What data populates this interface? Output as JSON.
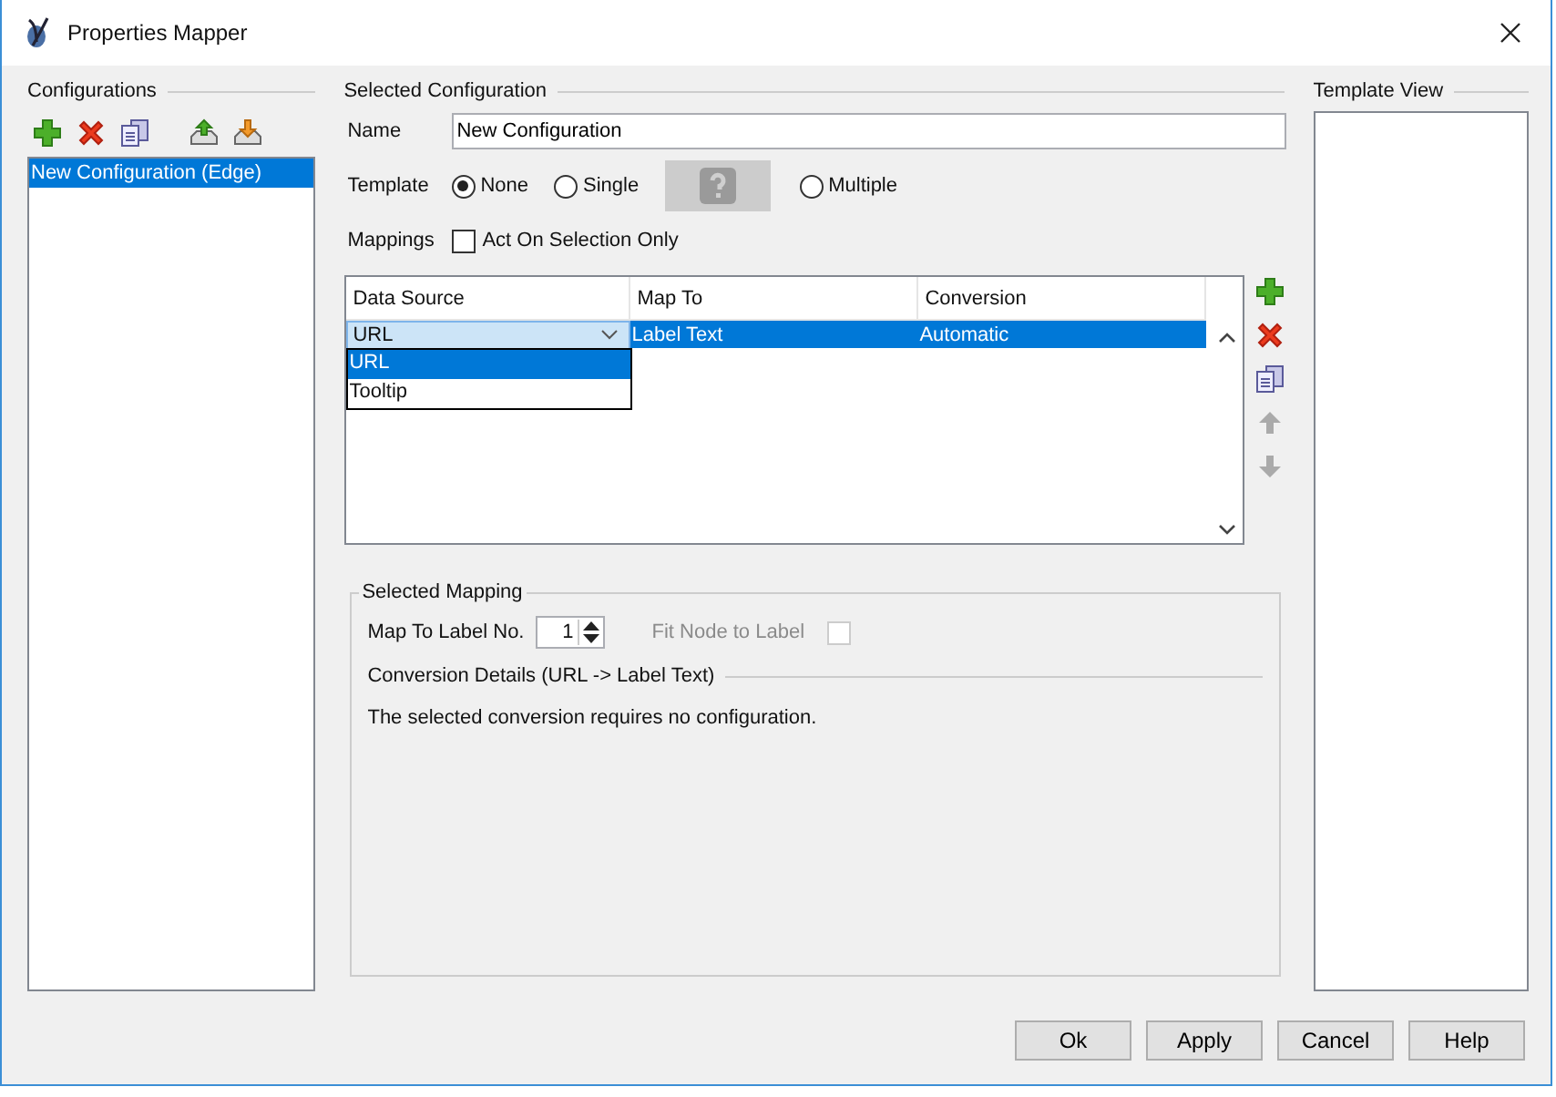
{
  "window": {
    "title": "Properties Mapper"
  },
  "configurations": {
    "title": "Configurations",
    "items": [
      {
        "label": "New Configuration (Edge)",
        "selected": true
      }
    ]
  },
  "selected_configuration": {
    "title": "Selected Configuration",
    "name": {
      "label": "Name",
      "value": "New Configuration"
    },
    "template": {
      "label": "Template",
      "options": [
        {
          "kind": "radio",
          "label": "None",
          "selected": true
        },
        {
          "kind": "radio",
          "label": "Single",
          "selected": false
        },
        {
          "kind": "preview"
        },
        {
          "kind": "radio",
          "label": "Multiple",
          "selected": false
        }
      ]
    },
    "mappings": {
      "label": "Mappings",
      "act_on_selection": {
        "label": "Act On Selection Only",
        "checked": false
      }
    },
    "table": {
      "columns": [
        "Data Source",
        "Map To",
        "Conversion"
      ],
      "rows": [
        {
          "cells": [
            "URL",
            "Label Text",
            "Automatic"
          ],
          "selected": true
        }
      ]
    },
    "dropdown": {
      "options": [
        {
          "label": "URL",
          "selected": true
        },
        {
          "label": "Tooltip",
          "selected": false
        }
      ]
    }
  },
  "selected_mapping": {
    "title": "Selected Mapping",
    "label_no": {
      "label": "Map To Label No.",
      "value": "1"
    },
    "fit_node": {
      "label": "Fit Node to Label",
      "checked": false,
      "disabled": true
    },
    "details_title": "Conversion Details (URL -> Label Text)",
    "message": "The selected conversion requires no configuration."
  },
  "template_view": {
    "title": "Template View"
  },
  "buttons": [
    "Ok",
    "Apply",
    "Cancel",
    "Help"
  ]
}
